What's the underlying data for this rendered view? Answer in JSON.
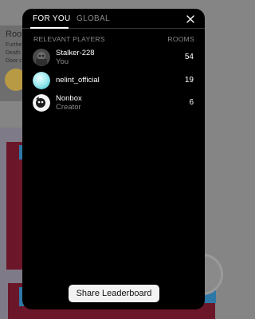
{
  "background": {
    "title": "Room",
    "lines": [
      "Furthe",
      "Death",
      "Door c"
    ]
  },
  "modal": {
    "tabs": [
      {
        "label": "FOR YOU",
        "active": true
      },
      {
        "label": "GLOBAL",
        "active": false
      }
    ],
    "close_icon": "close-icon",
    "columns": {
      "players": "RELEVANT PLAYERS",
      "rooms": "ROOMS"
    },
    "players": [
      {
        "name": "Stalker-228",
        "subtitle": "You",
        "rooms": "54",
        "avatar": "stalker-avatar"
      },
      {
        "name": "nelint_official",
        "subtitle": "",
        "rooms": "19",
        "avatar": "nelint-avatar"
      },
      {
        "name": "Nonbox",
        "subtitle": "Creator",
        "rooms": "6",
        "avatar": "nonbox-avatar"
      }
    ],
    "share_button": "Share Leaderboard"
  },
  "colors": {
    "modal_bg": "#000000",
    "inactive_text": "#8a8a8a",
    "button_bg": "#f2f2f2"
  }
}
